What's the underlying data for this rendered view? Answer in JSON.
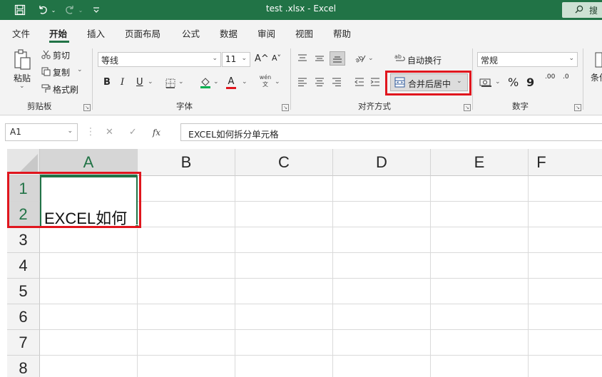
{
  "titlebar": {
    "title": "test .xlsx  -  Excel",
    "search_label": "搜",
    "icons": [
      "save-icon",
      "undo-icon",
      "redo-icon",
      "customize-qat-icon",
      "search-icon"
    ]
  },
  "tabs": [
    "文件",
    "开始",
    "插入",
    "页面布局",
    "公式",
    "数据",
    "审阅",
    "视图",
    "帮助"
  ],
  "active_tab": "开始",
  "ribbon": {
    "clipboard": {
      "paste": "粘贴",
      "cut": "剪切",
      "copy": "复制",
      "format_painter": "格式刷",
      "label": "剪贴板"
    },
    "font": {
      "font_name": "等线",
      "font_size": "11",
      "grow": "A^",
      "shrink": "A˅",
      "bold": "B",
      "italic": "I",
      "underline": "U",
      "font_color_letter": "A",
      "phonetic": "wén 文",
      "label": "字体"
    },
    "alignment": {
      "wrap_text": "自动换行",
      "merge_center": "合并后居中",
      "label": "对齐方式"
    },
    "number": {
      "format": "常规",
      "percent": "%",
      "comma": "9",
      "inc_decimal": ".00",
      "dec_decimal": ".0",
      "label": "数字"
    },
    "styles": {
      "conditional_partial": "条件"
    }
  },
  "formula_bar": {
    "name_box": "A1",
    "fx": "fx",
    "formula": "EXCEL如何拆分单元格"
  },
  "grid": {
    "columns": [
      "A",
      "B",
      "C",
      "D",
      "E",
      "F"
    ],
    "rows": [
      "1",
      "2",
      "3",
      "4",
      "5",
      "6",
      "7",
      "8"
    ],
    "merged_cell_text": "EXCEL如何"
  },
  "colors": {
    "excel_green": "#217346",
    "highlight_red": "#e0161e"
  }
}
